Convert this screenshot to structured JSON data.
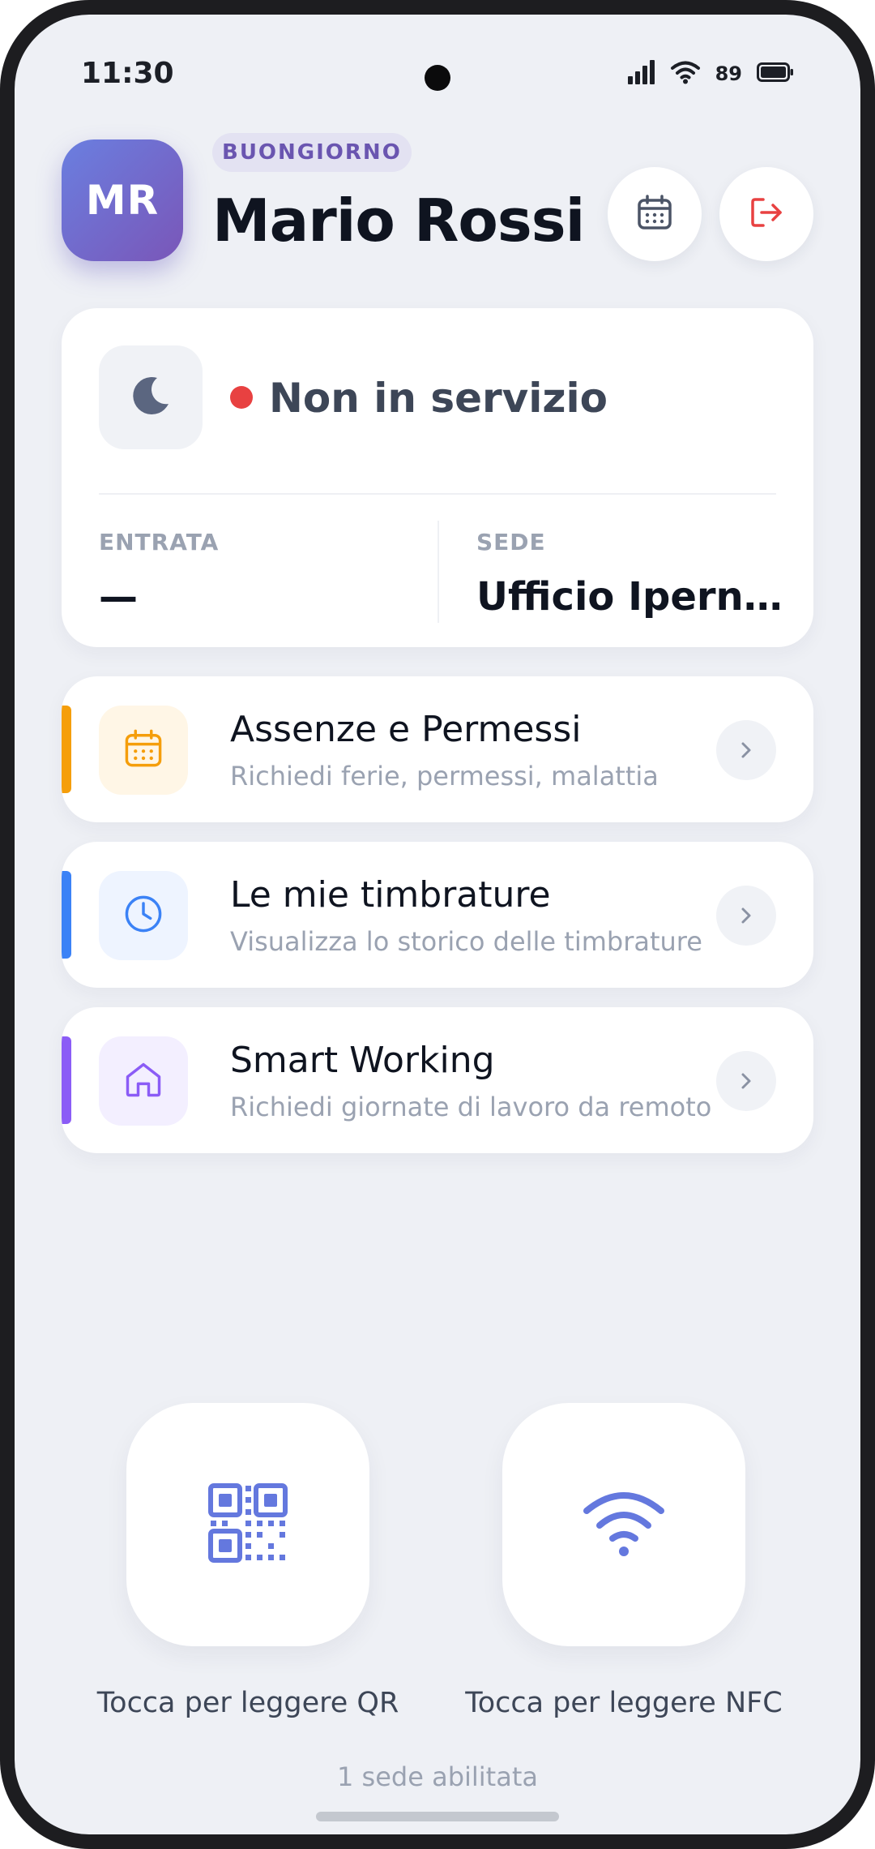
{
  "status_bar": {
    "time": "11:30",
    "battery_percent": "89",
    "icons": [
      "signal-icon",
      "wifi-icon",
      "battery-icon"
    ]
  },
  "header": {
    "avatar_initials": "MR",
    "greeting": "BUONGIORNO",
    "name": "Mario Rossi",
    "actions": [
      "calendar-icon",
      "logout-icon"
    ]
  },
  "status_card": {
    "status": "Non in servizio",
    "status_color": "#e84141",
    "entry_label": "ENTRATA",
    "entry_value": "—",
    "site_label": "SEDE",
    "site_value": "Ufficio Ipern..."
  },
  "menu": [
    {
      "title": "Assenze e Permessi",
      "subtitle": "Richiedi ferie, permessi, malattia",
      "icon": "calendar-icon",
      "accent": "#f59e0b"
    },
    {
      "title": "Le mie timbrature",
      "subtitle": "Visualizza lo storico delle timbrature",
      "icon": "clock-icon",
      "accent": "#3b82f6"
    },
    {
      "title": "Smart Working",
      "subtitle": "Richiedi giornate di lavoro da remoto",
      "icon": "home-icon",
      "accent": "#8b5cf6"
    }
  ],
  "scan": {
    "qr_label": "Tocca per leggere QR",
    "nfc_label": "Tocca per leggere NFC"
  },
  "footer": "1 sede abilitata"
}
